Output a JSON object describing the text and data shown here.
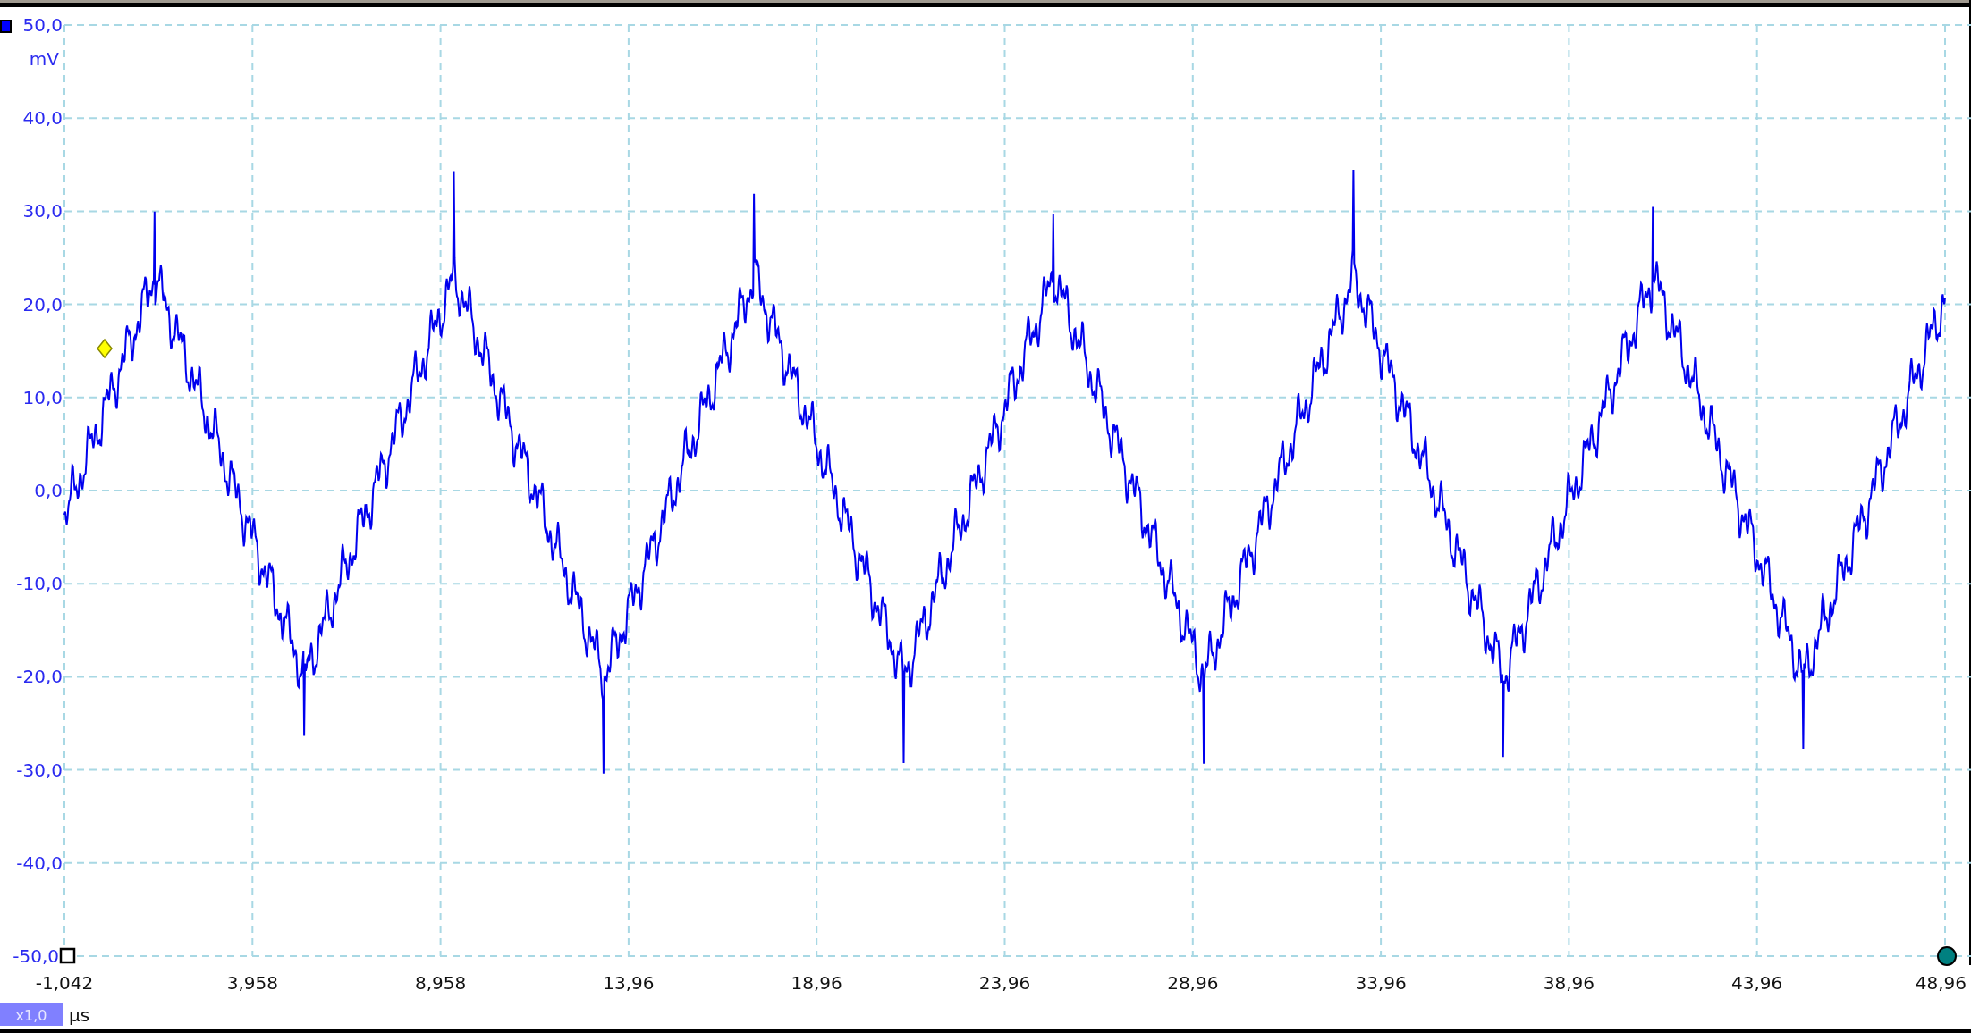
{
  "channel": {
    "unit": "mV",
    "y_ticks": [
      "50,0",
      "40,0",
      "30,0",
      "20,0",
      "10,0",
      "0,0",
      "-10,0",
      "-20,0",
      "-30,0",
      "-40,0",
      "-50,0"
    ]
  },
  "time_axis": {
    "ticks": [
      "-1,042",
      "3,958",
      "8,958",
      "13,96",
      "18,96",
      "23,96",
      "28,96",
      "33,96",
      "38,96",
      "43,96",
      "48,96"
    ],
    "unit": "µs",
    "zoom": "x1,0"
  }
}
